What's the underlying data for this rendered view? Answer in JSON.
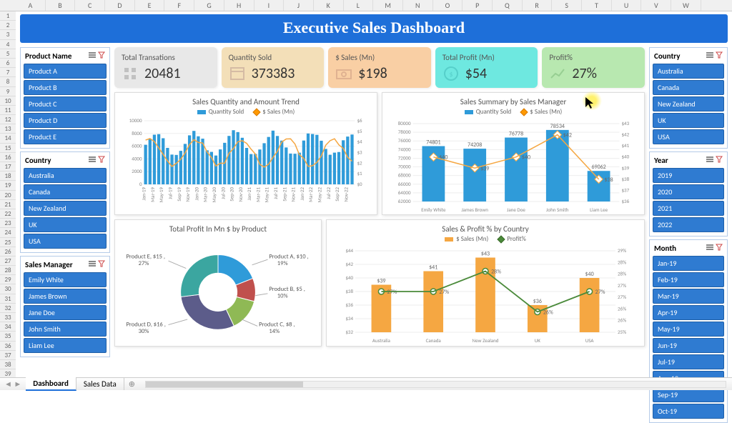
{
  "title": "Executive Sales Dashboard",
  "columns": [
    "A",
    "B",
    "C",
    "D",
    "E",
    "F",
    "G",
    "H",
    "I",
    "J",
    "K",
    "L",
    "M",
    "N",
    "O",
    "P",
    "Q",
    "R",
    "S",
    "T",
    "U",
    "V",
    "W"
  ],
  "slicers": {
    "product": {
      "title": "Product Name",
      "items": [
        "Product A",
        "Product B",
        "Product C",
        "Product D",
        "Product E"
      ]
    },
    "country_left": {
      "title": "Country",
      "items": [
        "Australia",
        "Canada",
        "New Zealand",
        "UK",
        "USA"
      ]
    },
    "manager": {
      "title": "Sales Manager",
      "items": [
        "Emily White",
        "James Brown",
        "Jane Doe",
        "John Smith",
        "Liam Lee"
      ]
    },
    "country_right": {
      "title": "Country",
      "items": [
        "Australia",
        "Canada",
        "New Zealand",
        "UK",
        "USA"
      ]
    },
    "year": {
      "title": "Year",
      "items": [
        "2019",
        "2020",
        "2021",
        "2022"
      ]
    },
    "month": {
      "title": "Month",
      "items": [
        "Jan-19",
        "Feb-19",
        "Mar-19",
        "Apr-19",
        "May-19",
        "Jun-19",
        "Jul-19",
        "Aug-19",
        "Sep-19",
        "Oct-19"
      ]
    }
  },
  "kpis": {
    "transactions": {
      "label": "Total Transations",
      "value": "20481"
    },
    "quantity": {
      "label": "Quantity Sold",
      "value": "373383"
    },
    "sales": {
      "label": "$ Sales (Mn)",
      "value": "$198"
    },
    "profit": {
      "label": "Total Profit (Mn)",
      "value": "$54"
    },
    "profitpct": {
      "label": "Profit%",
      "value": "27%"
    }
  },
  "chart1": {
    "title": "Sales Quantity and Amount Trend",
    "series1": "Quantity Sold",
    "series2": "$ Sales (Mn)",
    "y1_ticks": [
      "0",
      "2000",
      "4000",
      "6000",
      "8000",
      "10000"
    ],
    "y2_ticks": [
      "$0",
      "$1",
      "$2",
      "$3",
      "$4",
      "$5",
      "$6"
    ],
    "x": [
      "Jan-19",
      "Mar-19",
      "May-19",
      "Jul-19",
      "Sep-19",
      "Nov-19",
      "Jan-20",
      "Mar-20",
      "May-20",
      "Jul-20",
      "Sep-20",
      "Nov-20",
      "Jan-21",
      "Mar-21",
      "May-21",
      "Jul-21",
      "Sep-21",
      "Nov-21",
      "Jan-22",
      "Mar-22",
      "May-22",
      "Jul-22",
      "Sep-22",
      "Nov-22"
    ]
  },
  "chart2": {
    "title": "Sales Summary by Sales Manager",
    "series1": "Quantity Sold",
    "series2": "$ Sales (Mn)",
    "categories": [
      "Emily White",
      "James Brown",
      "Jane Doe",
      "John Smith",
      "Liam Lee"
    ],
    "qty": [
      74801,
      74208,
      76778,
      78534,
      69062
    ],
    "sales": [
      40,
      39,
      40,
      42,
      38
    ],
    "qty_labels": [
      "74801",
      "74208",
      "76778",
      "78534",
      "69062"
    ],
    "sales_labels": [
      "$40",
      "$39",
      "$40",
      "$42",
      "$38"
    ],
    "y1_ticks": [
      "62000",
      "64000",
      "66000",
      "68000",
      "70000",
      "72000",
      "74000",
      "76000",
      "78000",
      "80000"
    ],
    "y2_ticks": [
      "$36",
      "$37",
      "$38",
      "$39",
      "$40",
      "$41",
      "$42",
      "$43"
    ]
  },
  "chart3": {
    "title": "Total Profit In Mn $ by Product",
    "labels": {
      "a": "Product A, $10 , 19%",
      "b": "Product B, $5 , 10%",
      "c": "Product C, $8 , 14%",
      "d": "Product D, $16 , 30%",
      "e": "Product E, $15 , 27%"
    }
  },
  "chart4": {
    "title": "Sales & Profit % by Country",
    "series1": "$ Sales (Mn)",
    "series2": "Profit%",
    "categories": [
      "Australia",
      "Canada",
      "New Zealand",
      "UK",
      "USA"
    ],
    "sales": [
      39,
      41,
      43,
      36,
      40
    ],
    "profit": [
      27,
      27,
      28,
      26,
      27
    ],
    "sales_labels": [
      "$39",
      "$41",
      "$43",
      "$36",
      "$40"
    ],
    "profit_labels": [
      "27%",
      "27%",
      "28%",
      "26%",
      "27%"
    ],
    "y1_ticks": [
      "$32",
      "$34",
      "$36",
      "$38",
      "$40",
      "$42",
      "$44"
    ],
    "y2_ticks": [
      "25%",
      "26%",
      "26%",
      "27%",
      "27%",
      "28%",
      "28%",
      "29%"
    ]
  },
  "chart_data": [
    {
      "type": "bar+line",
      "title": "Sales Quantity and Amount Trend",
      "categories": [
        "Jan-19",
        "Mar-19",
        "May-19",
        "Jul-19",
        "Sep-19",
        "Nov-19",
        "Jan-20",
        "Mar-20",
        "May-20",
        "Jul-20",
        "Sep-20",
        "Nov-20",
        "Jan-21",
        "Mar-21",
        "May-21",
        "Jul-21",
        "Sep-21",
        "Nov-21",
        "Jan-22",
        "Mar-22",
        "May-22",
        "Jul-22",
        "Sep-22",
        "Nov-22"
      ],
      "series": [
        {
          "name": "Quantity Sold",
          "axis": "left",
          "type": "bar"
        },
        {
          "name": "$ Sales (Mn)",
          "axis": "right",
          "type": "line"
        }
      ],
      "y1lim": [
        0,
        10000
      ],
      "y2lim": [
        0,
        6
      ]
    },
    {
      "type": "bar+line",
      "title": "Sales Summary by Sales Manager",
      "categories": [
        "Emily White",
        "James Brown",
        "Jane Doe",
        "John Smith",
        "Liam Lee"
      ],
      "series": [
        {
          "name": "Quantity Sold",
          "values": [
            74801,
            74208,
            76778,
            78534,
            69062
          ],
          "type": "bar",
          "axis": "left"
        },
        {
          "name": "$ Sales (Mn)",
          "values": [
            40,
            39,
            40,
            42,
            38
          ],
          "type": "line",
          "axis": "right"
        }
      ],
      "y1lim": [
        62000,
        80000
      ],
      "y2lim": [
        36,
        43
      ]
    },
    {
      "type": "pie",
      "title": "Total Profit In Mn $ by Product",
      "categories": [
        "Product A",
        "Product B",
        "Product C",
        "Product D",
        "Product E"
      ],
      "values": [
        10,
        5,
        8,
        16,
        15
      ],
      "percentages": [
        19,
        10,
        14,
        30,
        27
      ]
    },
    {
      "type": "bar+line",
      "title": "Sales & Profit % by Country",
      "categories": [
        "Australia",
        "Canada",
        "New Zealand",
        "UK",
        "USA"
      ],
      "series": [
        {
          "name": "$ Sales (Mn)",
          "values": [
            39,
            41,
            43,
            36,
            40
          ],
          "type": "bar",
          "axis": "left"
        },
        {
          "name": "Profit%",
          "values": [
            27,
            27,
            28,
            26,
            27
          ],
          "type": "line",
          "axis": "right"
        }
      ],
      "y1lim": [
        32,
        44
      ],
      "y2lim": [
        25,
        29
      ]
    }
  ],
  "tabs": {
    "active": "Dashboard",
    "other": "Sales Data"
  }
}
